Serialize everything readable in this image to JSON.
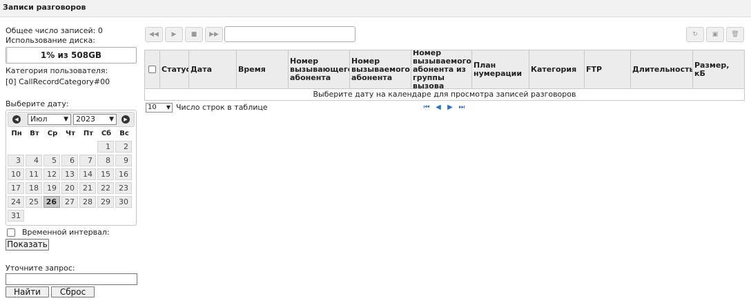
{
  "title": "Записи разговоров",
  "sidebar": {
    "total_records": "Общее число записей: 0",
    "disk_usage_label": "Использование диска:",
    "disk_usage_text": "1% из 508GB",
    "disk_usage_fraction": 0.01,
    "user_category_label": "Категория пользователя:",
    "user_category_value": "[0] CallRecordCategory#00",
    "select_date_label": "Выберите дату:",
    "interval_label": "Временной интервал:",
    "show_button": "Показать",
    "refine_label": "Уточните запрос:",
    "find_button": "Найти",
    "reset_button": "Сброс"
  },
  "calendar": {
    "month": "Июл",
    "year": "2023",
    "weekdays": [
      "Пн",
      "Вт",
      "Ср",
      "Чт",
      "Пт",
      "Сб",
      "Вс"
    ],
    "leading_blanks": 5,
    "days": [
      "1",
      "2",
      "3",
      "4",
      "5",
      "6",
      "7",
      "8",
      "9",
      "10",
      "11",
      "12",
      "13",
      "14",
      "15",
      "16",
      "17",
      "18",
      "19",
      "20",
      "21",
      "22",
      "23",
      "24",
      "25",
      "26",
      "27",
      "28",
      "29",
      "30",
      "31"
    ],
    "selected_day": "26"
  },
  "table": {
    "columns": [
      "",
      "Статус",
      "Дата",
      "Время",
      "Номер вызывающего абонента",
      "Номер вызываемого абонента",
      "Номер вызываемого абонента из группы вызова",
      "План нумерации",
      "Категория",
      "FTP",
      "Длительность",
      "Размер, кБ"
    ],
    "empty_message": "Выберите дату на календаре для просмотра записей разговоров"
  },
  "pager": {
    "rows_value": "10",
    "rows_label": "Число строк в таблице"
  },
  "icons": {
    "player": [
      "rewind-icon",
      "play-icon",
      "stop-icon",
      "forward-icon"
    ],
    "actions": [
      "refresh-icon",
      "save-icon",
      "delete-icon"
    ]
  }
}
